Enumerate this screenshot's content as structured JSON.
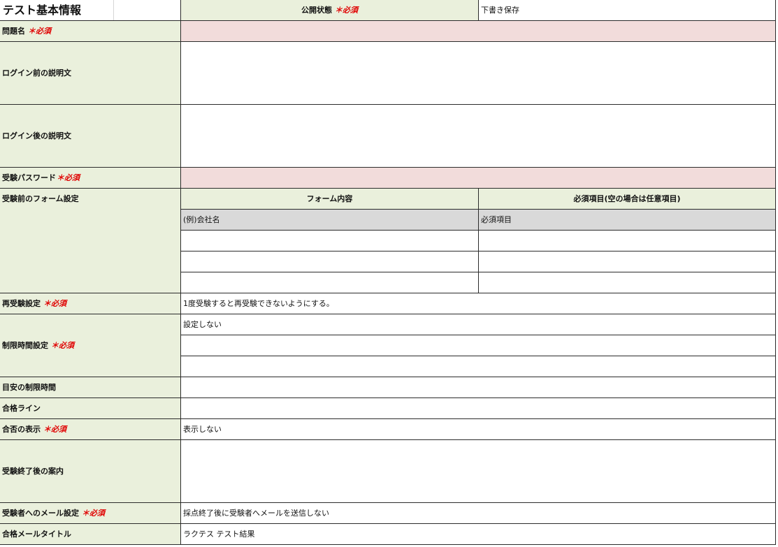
{
  "sheet": {
    "title": "テスト基本情報",
    "required_mark": "＊必須",
    "publish": {
      "label": "公開状態",
      "value": "下書き保存"
    },
    "question_name": {
      "label": "問題名",
      "value": ""
    },
    "pre_login_description": {
      "label": "ログイン前の説明文",
      "value": ""
    },
    "post_login_description": {
      "label": "ログイン後の説明文",
      "value": ""
    },
    "password": {
      "label": "受験パスワード",
      "value": ""
    },
    "form_settings": {
      "label": "受験前のフォーム設定",
      "columns": [
        "フォーム内容",
        "必須項目(空の場合は任意項目)"
      ],
      "rows": [
        [
          "(例)会社名",
          "必須項目"
        ],
        [
          "",
          ""
        ],
        [
          "",
          ""
        ],
        [
          "",
          ""
        ]
      ]
    },
    "retake": {
      "label": "再受験設定",
      "value": "1度受験すると再受験できないようにする。"
    },
    "time_limit": {
      "label": "制限時間設定",
      "values": [
        "設定しない",
        "",
        ""
      ]
    },
    "guide_time": {
      "label": "目安の制限時間",
      "value": ""
    },
    "pass_line": {
      "label": "合格ライン",
      "value": ""
    },
    "pass_display": {
      "label": "合否の表示",
      "value": "表示しない"
    },
    "after_guide": {
      "label": "受験終了後の案内",
      "value": ""
    },
    "mail_setting": {
      "label": "受験者へのメール設定",
      "value": "採点終了後に受験者へメールを送信しない"
    },
    "mail_title": {
      "label": "合格メールタイトル",
      "value": "ラクテス テスト結果"
    }
  },
  "colors": {
    "label_bg": "#eaf0dc",
    "required_bg": "#f2dcdb",
    "example_bg": "#d9d9d9",
    "required_text": "#e00000"
  }
}
